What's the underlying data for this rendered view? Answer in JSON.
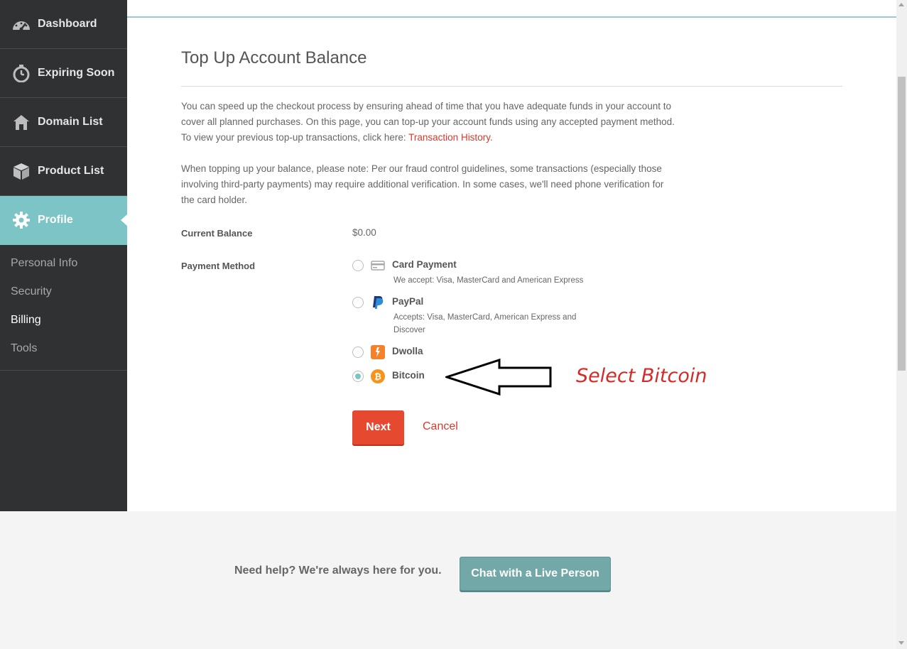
{
  "sidebar": {
    "items": [
      {
        "label": "Dashboard",
        "icon": "speedometer-icon"
      },
      {
        "label": "Expiring Soon",
        "icon": "stopwatch-icon"
      },
      {
        "label": "Domain List",
        "icon": "house-icon"
      },
      {
        "label": "Product List",
        "icon": "box-icon"
      },
      {
        "label": "Profile",
        "icon": "gear-icon"
      }
    ],
    "subitems": [
      {
        "label": "Personal Info"
      },
      {
        "label": "Security"
      },
      {
        "label": "Billing"
      },
      {
        "label": "Tools"
      }
    ]
  },
  "main": {
    "title": "Top Up Account Balance",
    "para1_text": "You can speed up the checkout process by ensuring ahead of time that you have adequate funds in your account to cover all planned purchases. On this page, you can top-up your account funds using any accepted payment method. To view your previous top-up transactions, click here: ",
    "para1_link": "Transaction History",
    "para1_end": ".",
    "para2": "When topping up your balance, please note: Per our fraud control guidelines, some transactions (especially those involving third-party payments) may require additional verification. In some cases, we'll need phone verification for the card holder.",
    "current_balance_label": "Current Balance",
    "current_balance_value": "$0.00",
    "payment_method_label": "Payment Method",
    "options": [
      {
        "name": "Card Payment",
        "desc": "We accept: Visa, MasterCard and American Express",
        "icon": "credit-card-icon",
        "selected": false
      },
      {
        "name": "PayPal",
        "desc": "Accepts: Visa, MasterCard, American Express and Discover",
        "icon": "paypal-icon",
        "selected": false
      },
      {
        "name": "Dwolla",
        "desc": "",
        "icon": "dwolla-icon",
        "selected": false
      },
      {
        "name": "Bitcoin",
        "desc": "",
        "icon": "bitcoin-icon",
        "selected": true
      }
    ],
    "next_label": "Next",
    "cancel_label": "Cancel"
  },
  "annotation": {
    "text": "Select Bitcoin",
    "color": "#d62a26"
  },
  "footer": {
    "help_text": "Need help? We're always here for you.",
    "chat_label": "Chat with a Live Person"
  },
  "colors": {
    "sidebar_bg": "#2f3133",
    "active_teal": "#7cc4c5",
    "accent_red": "#e5492f",
    "link_red": "#d7392b",
    "chat_btn": "#73a8a9"
  }
}
